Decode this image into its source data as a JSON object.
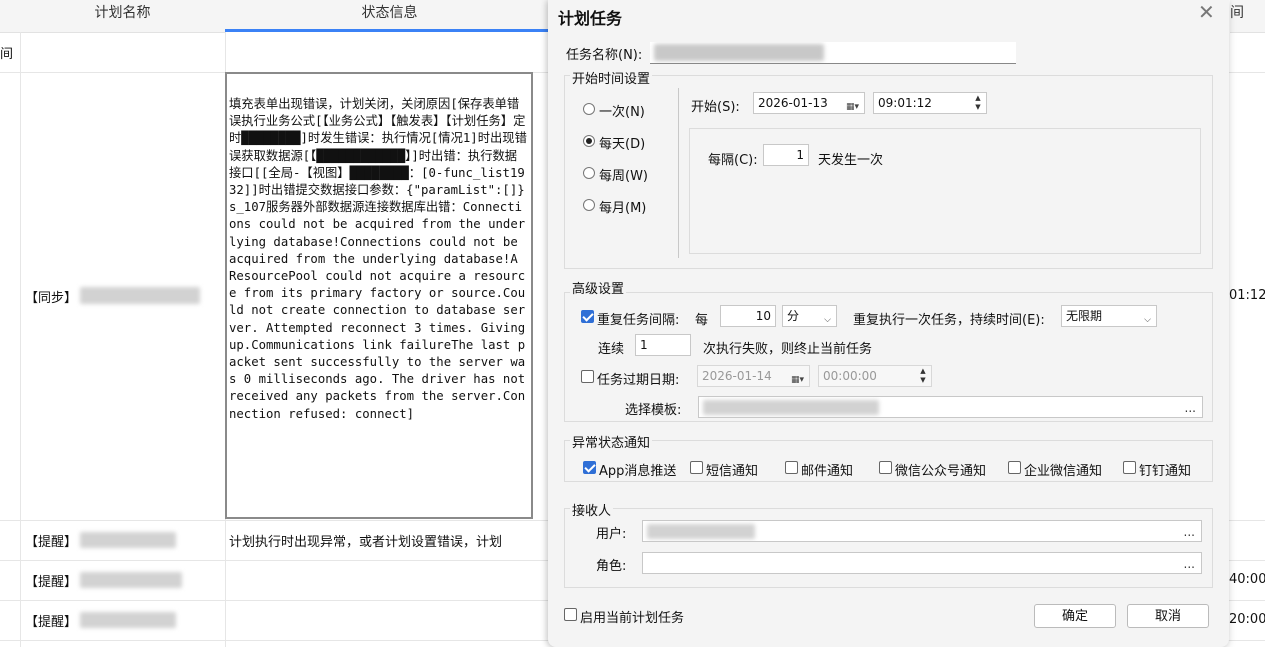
{
  "table": {
    "col_plan_name": "计划名称",
    "col_status": "状态信息",
    "col_right_partial": "间",
    "right_edge_header": "间",
    "rows": [
      {
        "tag": "【同步】",
        "time_partial": "01:12"
      },
      {
        "tag": "【提醒】",
        "status_text": "计划执行时出现异常，或者计划设置错误，计划"
      },
      {
        "tag": "【提醒】",
        "time_partial": "40:00"
      },
      {
        "tag": "【提醒】",
        "time_partial": "20:00"
      }
    ],
    "status_detail": "填充表单出现错误，计划关闭，关闭原因[保存表单错误执行业务公式[【业务公式】【触发表】【计划任务】定时████████]时发生错误：执行情况[情况1]时出现错误获取数据源[【████████████】]时出错：执行数据接口[[全局-【视图】████████：[0-func_list1932]]时出错提交数据接口参数：{\"paramList\":[]}s_107服务器外部数据源连接数据库出错：Connections could not be acquired from the underlying database!Connections could not be acquired from the underlying database!A ResourcePool could not acquire a resource from its primary factory or source.Could not create connection to database server. Attempted reconnect 3 times. Giving up.Communications link failureThe last packet sent successfully to the server was 0 milliseconds ago. The driver has not received any packets from the server.Connection refused: connect]"
  },
  "dialog": {
    "title": "计划任务",
    "close_icon": "✕",
    "task_name_label": "任务名称(N):",
    "start_group_title": "开始时间设置",
    "radios": [
      {
        "label": "一次(N)",
        "selected": false
      },
      {
        "label": "每天(D)",
        "selected": true
      },
      {
        "label": "每周(W)",
        "selected": false
      },
      {
        "label": "每月(M)",
        "selected": false
      }
    ],
    "start_label": "开始(S):",
    "start_date": "2026-01-13",
    "start_time": "09:01:12",
    "interval_label": "每隔(C):",
    "interval_value": "1",
    "interval_suffix": "天发生一次",
    "advanced_title": "高级设置",
    "repeat_checked": true,
    "repeat_label": "重复任务间隔:",
    "repeat_every": "每",
    "repeat_value": "10",
    "repeat_unit": "分",
    "repeat_duration_label": "重复执行一次任务，持续时间(E):",
    "repeat_duration_value": "无限期",
    "continuous_label": "连续",
    "continuous_value": "1",
    "continuous_suffix": "次执行失败，则终止当前任务",
    "expire_checked": false,
    "expire_label": "任务过期日期:",
    "expire_date": "2026-01-14",
    "expire_time": "00:00:00",
    "template_label": "选择模板:",
    "ellipsis": "...",
    "notify_title": "异常状态通知",
    "notify_options": [
      {
        "label": "App消息推送",
        "checked": true
      },
      {
        "label": "短信通知",
        "checked": false
      },
      {
        "label": "邮件通知",
        "checked": false
      },
      {
        "label": "微信公众号通知",
        "checked": false
      },
      {
        "label": "企业微信通知",
        "checked": false
      },
      {
        "label": "钉钉通知",
        "checked": false
      }
    ],
    "receiver_title": "接收人",
    "user_label": "用户:",
    "role_label": "角色:",
    "enable_label": "启用当前计划任务",
    "enable_checked": false,
    "ok_label": "确定",
    "cancel_label": "取消"
  }
}
